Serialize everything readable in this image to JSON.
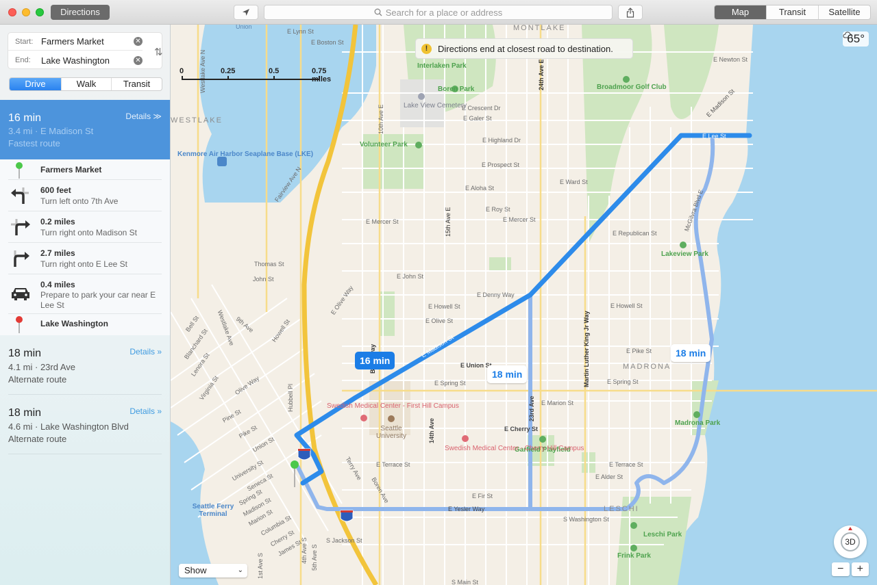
{
  "window": {
    "directions_button": "Directions",
    "search_placeholder": "Search for a place or address",
    "map_modes": [
      "Map",
      "Transit",
      "Satellite"
    ],
    "active_map_mode": "Map"
  },
  "sidebar": {
    "start_label": "Start:",
    "start_value": "Farmers Market",
    "end_label": "End:",
    "end_value": "Lake Washington",
    "transport_modes": [
      "Drive",
      "Walk",
      "Transit"
    ],
    "active_transport_mode": "Drive",
    "selected_route": {
      "time": "16 min",
      "summary": "3.4 mi · E Madison St",
      "note": "Fastest route",
      "details_label": "Details ≫"
    },
    "steps": [
      {
        "icon": "green-pin-icon",
        "title": "Farmers Market",
        "desc": ""
      },
      {
        "icon": "turn-left-icon",
        "title": "600 feet",
        "desc": "Turn left onto 7th Ave"
      },
      {
        "icon": "turn-right-icon",
        "title": "0.2 miles",
        "desc": "Turn right onto Madison St"
      },
      {
        "icon": "turn-right-icon",
        "title": "2.7 miles",
        "desc": "Turn right onto E Lee St"
      },
      {
        "icon": "car-icon",
        "title": "0.4 miles",
        "desc": "Prepare to park your car near E Lee St"
      },
      {
        "icon": "red-pin-icon",
        "title": "Lake Washington",
        "desc": ""
      }
    ],
    "alternate_routes": [
      {
        "time": "18 min",
        "summary": "4.1 mi · 23rd Ave",
        "note": "Alternate route",
        "details_label": "Details »"
      },
      {
        "time": "18 min",
        "summary": "4.6 mi · Lake Washington Blvd",
        "note": "Alternate route",
        "details_label": "Details »"
      }
    ]
  },
  "map": {
    "notice": "Directions end at closest road to destination.",
    "weather": {
      "icon": "cloud-icon",
      "temperature": "65°"
    },
    "scale_ticks": [
      "0",
      "0.25",
      "0.5",
      "0.75 miles"
    ],
    "route_callouts": [
      {
        "label": "16 min",
        "selected": true
      },
      {
        "label": "18 min",
        "selected": false
      },
      {
        "label": "18 min",
        "selected": false
      }
    ],
    "show_menu": "Show",
    "compass_label": "3D",
    "zoom_out": "−",
    "zoom_in": "+",
    "labels": {
      "union": "Union",
      "montlake": "MONTLAKE",
      "eastlake": "WESTLAKE",
      "madrona": "MADRONA",
      "leschi": "LESCHI",
      "interlaken": "Interlaken Park",
      "boren": "Boren Park",
      "lakeview_cem": "Lake View Cemetery",
      "volunteer": "Volunteer Park",
      "broadmoor": "Broadmoor Golf Club",
      "kenmore": "Kenmore Air Harbor Seaplane Base (LKE)",
      "lakeview_park": "Lakeview Park",
      "madrona_park": "Madrona Park",
      "garfield": "Garfield Playfield",
      "leschi_park": "Leschi Park",
      "frink": "Frink Park",
      "swedish1": "Swedish Medical Center - First Hill Campus",
      "swedish2": "Swedish Medical Center - Cherry Hill Campus",
      "seattle_u": "Seattle University",
      "ferry": "Seattle Ferry Terminal",
      "e_madison_st": "E Madison St",
      "e_lee_st": "E Lee St",
      "e_union_st": "E Union St",
      "e_spring_st": "E Spring St",
      "e_cherry_st": "E Cherry St",
      "e_yesler_way": "E Yesler Way",
      "e_terrace_st": "E Terrace St",
      "e_alder_st": "E Alder St",
      "e_fir_st": "E Fir St",
      "e_pike_st": "E Pike St",
      "e_howell_st": "E Howell St",
      "e_olive_st": "E Olive St",
      "e_denny_way": "E Denny Way",
      "e_john_st": "E John St",
      "e_mercer_st": "E Mercer St",
      "e_roy_st": "E Roy St",
      "e_aloha_st": "E Aloha St",
      "e_prospect_st": "E Prospect St",
      "e_highland_dr": "E Highland Dr",
      "e_galer_st": "E Galer St",
      "e_crescent_dr": "E Crescent Dr",
      "e_ward_st": "E Ward St",
      "e_republican_st": "E Republican St",
      "e_lynn_st": "E Lynn St",
      "e_boston_st": "E Boston St",
      "e_newton_st": "E Newton St",
      "e_marion_st": "E Marion St",
      "s_jackson_st": "S Jackson St",
      "s_washington_st": "S Washington St",
      "s_main_st": "S Main St",
      "thomas_st": "Thomas St",
      "john_st": "John St",
      "fairview": "Fairview Ave N",
      "westlake": "Westlake Ave N",
      "e_olive_way": "E Olive Way",
      "broadway": "Broadway",
      "mlk": "Martin Luther King Jr Way",
      "mcgilvra": "McGilvra Blvd E",
      "ave_14th": "14th Ave",
      "ave_23rd": "23rd Ave",
      "ave_10th": "10th Ave E",
      "ave_24th": "24th Ave E",
      "ave_15th": "15th Ave E",
      "bell": "Bell St",
      "blanchard": "Blanchard St",
      "lenora": "Lenora St",
      "virginia": "Virginia St",
      "westlake_ave": "Westlake Ave",
      "ninth": "9th Ave",
      "howell": "Howell St",
      "olive_way": "Olive Way",
      "pine": "Pine St",
      "pike": "Pike St",
      "union_st": "Union St",
      "university": "University St",
      "seneca": "Seneca St",
      "spring": "Spring St",
      "madison": "Madison St",
      "marion": "Marion St",
      "columbia": "Columbia St",
      "cherry": "Cherry St",
      "james": "James St",
      "hubbell": "Hubbell Pl",
      "terry": "Terry Ave",
      "boren_ave": "Boren Ave",
      "ave_4th": "4th Ave S",
      "ave_5th": "5th Ave S",
      "ave_1st": "1st Ave S",
      "i5": "5"
    }
  }
}
